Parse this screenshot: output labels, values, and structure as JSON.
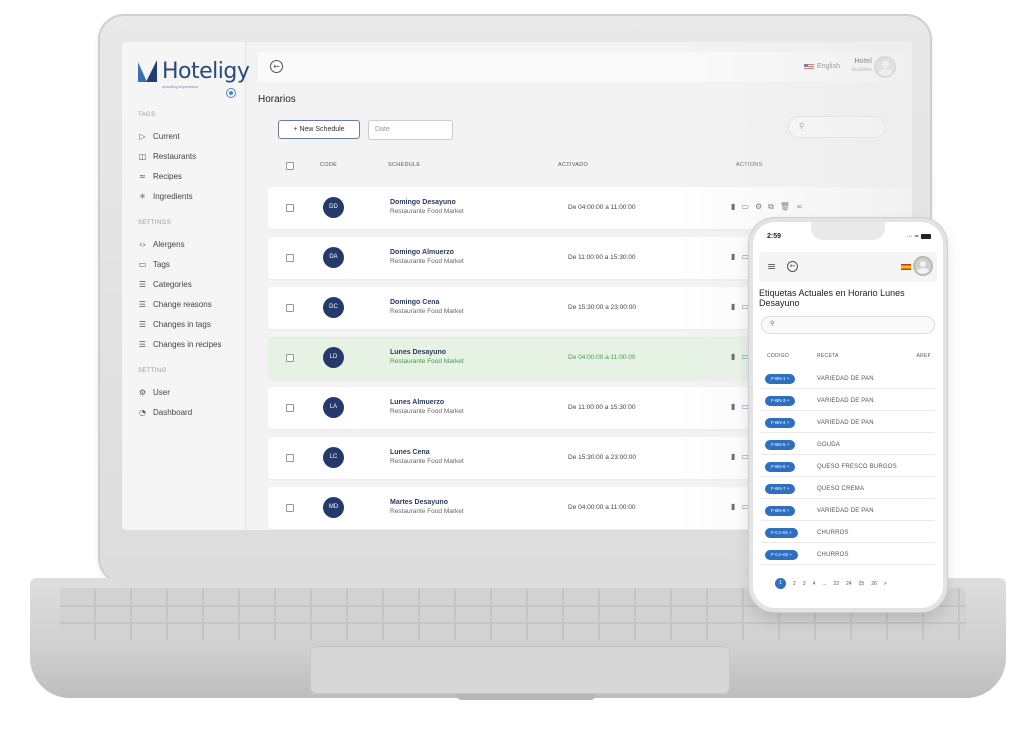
{
  "app": {
    "logo_text": "Hoteligy",
    "logo_tagline": "upselling experience"
  },
  "sidebar": {
    "sections": [
      {
        "title": "TAGS",
        "items": [
          {
            "label": "Current",
            "icon": "play-outline-icon"
          },
          {
            "label": "Restaurants",
            "icon": "panel-icon"
          },
          {
            "label": "Recipes",
            "icon": "layers-icon"
          },
          {
            "label": "Ingredients",
            "icon": "bug-icon"
          }
        ]
      },
      {
        "title": "SETTINGS",
        "items": [
          {
            "label": "Alergens",
            "icon": "code-icon"
          },
          {
            "label": "Tags",
            "icon": "monitor-icon"
          },
          {
            "label": "Categories",
            "icon": "list-icon"
          },
          {
            "label": "Change reasons",
            "icon": "list-icon"
          },
          {
            "label": "Changes in tags",
            "icon": "list-icon"
          },
          {
            "label": "Changes in recipes",
            "icon": "list-icon"
          }
        ]
      },
      {
        "title": "SETTING",
        "items": [
          {
            "label": "User",
            "icon": "gear-icon"
          },
          {
            "label": "Dashboard",
            "icon": "pie-chart-icon"
          }
        ]
      }
    ]
  },
  "header": {
    "language": "English",
    "hotel_name": "Hotel",
    "hotel_status": "Available"
  },
  "main": {
    "title": "Horarios",
    "new_button": "+ New Schedule",
    "date_placeholder": "Date",
    "columns": [
      "CODE",
      "SCHEDULE",
      "ACTIVADO",
      "ACTIONS"
    ],
    "rows": [
      {
        "code": "DD",
        "name": "Domingo Desayuno",
        "venue": "Restaurante Food Market",
        "time": "De 04:00:00 a 11:00:00",
        "active": false
      },
      {
        "code": "DA",
        "name": "Domingo Almuerzo",
        "venue": "Restaurante Food Market",
        "time": "De 11:00:00 a 15:30:00",
        "active": false
      },
      {
        "code": "DC",
        "name": "Domingo Cena",
        "venue": "Restaurante Food Market",
        "time": "De 15:30:00 a 23:00:00",
        "active": false
      },
      {
        "code": "LD",
        "name": "Lunes Desayuno",
        "venue": "Restaurante Food Market",
        "time": "De 04:00:00 a 11:00:00",
        "active": true
      },
      {
        "code": "LA",
        "name": "Lunes Almuerzo",
        "venue": "Restaurante Food Market",
        "time": "De 11:00:00 a 15:30:00",
        "active": false
      },
      {
        "code": "LC",
        "name": "Lunes Cena",
        "venue": "Restaurante Food Market",
        "time": "De 15:30:00 a 23:00:00",
        "active": false
      },
      {
        "code": "MD",
        "name": "Martes Desayuno",
        "venue": "Restaurante Food Market",
        "time": "De 04:00:00 a 11:00:00",
        "active": false
      }
    ]
  },
  "phone": {
    "status_time": "2:59",
    "title": "Etiquetas Actuales en Horario Lunes Desayuno",
    "columns": [
      "CODIGO",
      "RECETA",
      "AREF"
    ],
    "rows": [
      {
        "code": "F-BN-1",
        "name": "VARIEDAD DE PAN"
      },
      {
        "code": "F-BN-3",
        "name": "VARIEDAD DE PAN"
      },
      {
        "code": "F-BN-4",
        "name": "VARIEDAD DE PAN"
      },
      {
        "code": "F-BN-5",
        "name": "GOUDA"
      },
      {
        "code": "F-BN-6",
        "name": "QUESO FRESCO BURGOS"
      },
      {
        "code": "F-BN-7",
        "name": "QUESO CREMA"
      },
      {
        "code": "F-BN-8",
        "name": "VARIEDAD DE PAN"
      },
      {
        "code": "F-CA-01",
        "name": "CHURROS"
      },
      {
        "code": "F-CA-02",
        "name": "CHURROS"
      }
    ],
    "pages": [
      "1",
      "2",
      "3",
      "4",
      "...",
      "22",
      "24",
      "25",
      "26",
      ">"
    ],
    "current_page": "1"
  },
  "colors": {
    "brand_navy": "#253a6b",
    "chip_blue": "#2f6fc0",
    "active_row_bg": "#e6f2e4",
    "active_text": "#4a9a46"
  }
}
